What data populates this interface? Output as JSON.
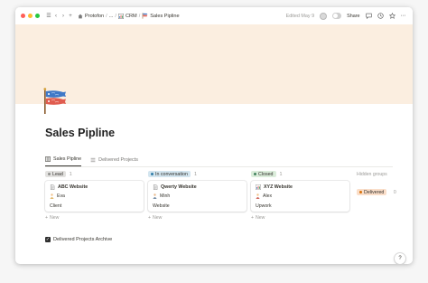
{
  "window": {
    "traffic_lights": {
      "close": "#ff5f57",
      "minimize": "#febc2e",
      "maximize": "#28c840"
    }
  },
  "topbar": {
    "breadcrumbs": [
      {
        "icon": "house-icon",
        "label": "Protofon"
      },
      {
        "icon": "",
        "label": "..."
      },
      {
        "icon": "chart-icon",
        "label": "CRM"
      },
      {
        "icon": "flag-icon",
        "label": "Sales Pipline"
      }
    ],
    "edited_label": "Edited May 9",
    "share_label": "Share"
  },
  "page": {
    "cover_color": "#fbeee0",
    "icon": "carp-streamer-icon",
    "title": "Sales Pipline",
    "views": [
      {
        "icon": "board-icon",
        "label": "Sales Pipline",
        "active": true
      },
      {
        "icon": "list-icon",
        "label": "Delivered Projects",
        "active": false
      }
    ]
  },
  "board": {
    "new_label": "New",
    "groups": [
      {
        "status": "Lead",
        "count": "1",
        "color": "#e3e2e0",
        "dot": "#91918e",
        "card": {
          "icon": "document-icon",
          "title": "ABC Website",
          "person_icon": "person-icon",
          "person": "Eva",
          "type": "Client"
        }
      },
      {
        "status": "In conversation",
        "count": "1",
        "color": "#d3e5ef",
        "dot": "#337ea9",
        "card": {
          "icon": "document-icon",
          "title": "Qwerty Website",
          "person_icon": "person-icon",
          "person": "Minh",
          "type": "Website"
        }
      },
      {
        "status": "Closed",
        "count": "1",
        "color": "#dbeddb",
        "dot": "#448361",
        "card": {
          "icon": "chart-icon",
          "title": "XYZ Website",
          "person_icon": "person-icon",
          "person": "Alex",
          "type": "Upwork"
        }
      }
    ],
    "hidden_groups_label": "Hidden groups",
    "hidden_group": {
      "status": "Delivered",
      "count": "0",
      "color": "#fadec9",
      "dot": "#d9730d"
    }
  },
  "archive": {
    "label": "Delivered Projects Archive",
    "checked": true
  },
  "help_label": "?"
}
